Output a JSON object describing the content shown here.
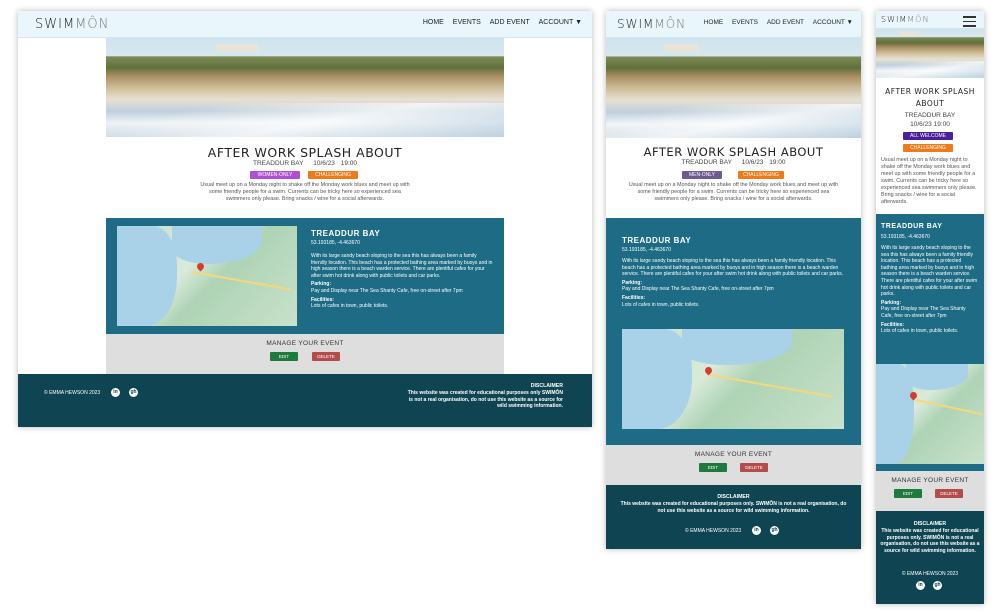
{
  "brand": {
    "prefix": "SWIM",
    "suffix": "MÔN"
  },
  "nav": {
    "home": "HOME",
    "events": "EVENTS",
    "add_event": "ADD EVENT",
    "account": "ACCOUNT ▼"
  },
  "desktop": {
    "event": {
      "title": "AFTER WORK SPLASH ABOUT",
      "location": "TREADDUR BAY",
      "date": "10/6/23",
      "time": "19:00",
      "badges": [
        "WOMEN-ONLY",
        "CHALLENGING"
      ],
      "description": "Usual meet up on a Monday night to shake off the Monday work blues and meet up with some friendly people for a swim. Currents can be tricky here so experienced sea swimmers only please. Bring snacks / wine for a social afterwards."
    }
  },
  "tablet": {
    "event": {
      "title": "AFTER WORK SPLASH ABOUT",
      "location": "TREADDUR BAY",
      "date": "10/6/23",
      "time": "19:00",
      "badges": [
        "MEN-ONLY",
        "CHALLENGING"
      ],
      "description": "Usual meet up on a Monday night to shake off the Monday work blues and meet up with some friendly people for a swim. Currents can be tricky here so experienced sea swimmers only please. Bring snacks / wine for a social afterwards."
    }
  },
  "mobile": {
    "event": {
      "title": "AFTER WORK SPLASH ABOUT",
      "location": "TREADDUR BAY",
      "datetime": "10/6/23 19:00",
      "badges": [
        "ALL WELCOME",
        "CHALLENGING"
      ],
      "description": "Usual meet up on a Monday night to shake off the Monday work blues and meet up with some friendly people for a swim. Currents can be tricky here so experienced sea swimmers only please. Bring snacks / wine for a social afterwards."
    }
  },
  "location": {
    "name": "TREADDUR BAY",
    "coords": "53.193185, -4.463670",
    "about": "With its large sandy beach sloping to the sea this has always been a family friendly location. This beach has a protected bathing area marked by buoys and in high season there is a beach warden service. There are plentiful cafes for your after swim hot drink along with public toilets and car parks.",
    "parking_label": "Parking:",
    "parking": "Pay and Display near The Sea Shanty Cafe, free on-street after 7pm",
    "facilities_label": "Facilities:",
    "facilities": "Lots of cafes in town, public toilets."
  },
  "manage": {
    "title": "MANAGE YOUR EVENT",
    "edit": "EDIT",
    "delete": "DELETE"
  },
  "footer": {
    "copyright": "© EMMA HEWSON 2023",
    "disclaimer_title": "DISCLAIMER",
    "disclaimer_short": "This website was created for educational purposes only SWIMÔN is not a real organisation, do not use this website as a source for wild swimming information.",
    "disclaimer_long": "This website was created for educational purposes only. SWIMÔN is not a real organisation, do not use this website as a source for wild swimming information.",
    "social": [
      "in",
      "gh"
    ]
  },
  "colors": {
    "nav_bg": "#e9f6fb",
    "location_bg": "#1d6b85",
    "footer_bg": "#0f4452",
    "women_only": "#b04fd1",
    "men_only": "#6e5a8f",
    "all_welcome": "#4a1f9c",
    "challenging": "#ef7a1a",
    "edit": "#1f7a3d",
    "delete": "#b44c4c"
  },
  "icons": [
    "linkedin-icon",
    "github-icon",
    "map-pin-icon",
    "hamburger-menu-icon"
  ]
}
